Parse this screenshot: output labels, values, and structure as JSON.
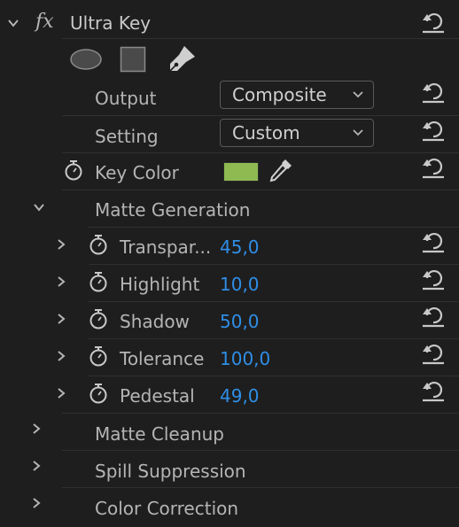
{
  "effect": {
    "fx_label": "fx",
    "name": "Ultra Key",
    "shape_icons": [
      "ellipse-mask-icon",
      "rectangle-mask-icon",
      "pen-mask-icon"
    ]
  },
  "output": {
    "label": "Output",
    "value": "Composite"
  },
  "setting": {
    "label": "Setting",
    "value": "Custom"
  },
  "key_color": {
    "label": "Key Color",
    "color": "#8fba52"
  },
  "matte_generation": {
    "label": "Matte Generation",
    "params": [
      {
        "label": "Transpar...",
        "value": "45,0"
      },
      {
        "label": "Highlight",
        "value": "10,0"
      },
      {
        "label": "Shadow",
        "value": "50,0"
      },
      {
        "label": "Tolerance",
        "value": "100,0"
      },
      {
        "label": "Pedestal",
        "value": "49,0"
      }
    ]
  },
  "sections": [
    {
      "label": "Matte Cleanup"
    },
    {
      "label": "Spill Suppression"
    },
    {
      "label": "Color Correction"
    }
  ],
  "colors": {
    "value_blue": "#2f8ee6",
    "text": "#b5b5b5",
    "background": "#1e1e1e"
  }
}
